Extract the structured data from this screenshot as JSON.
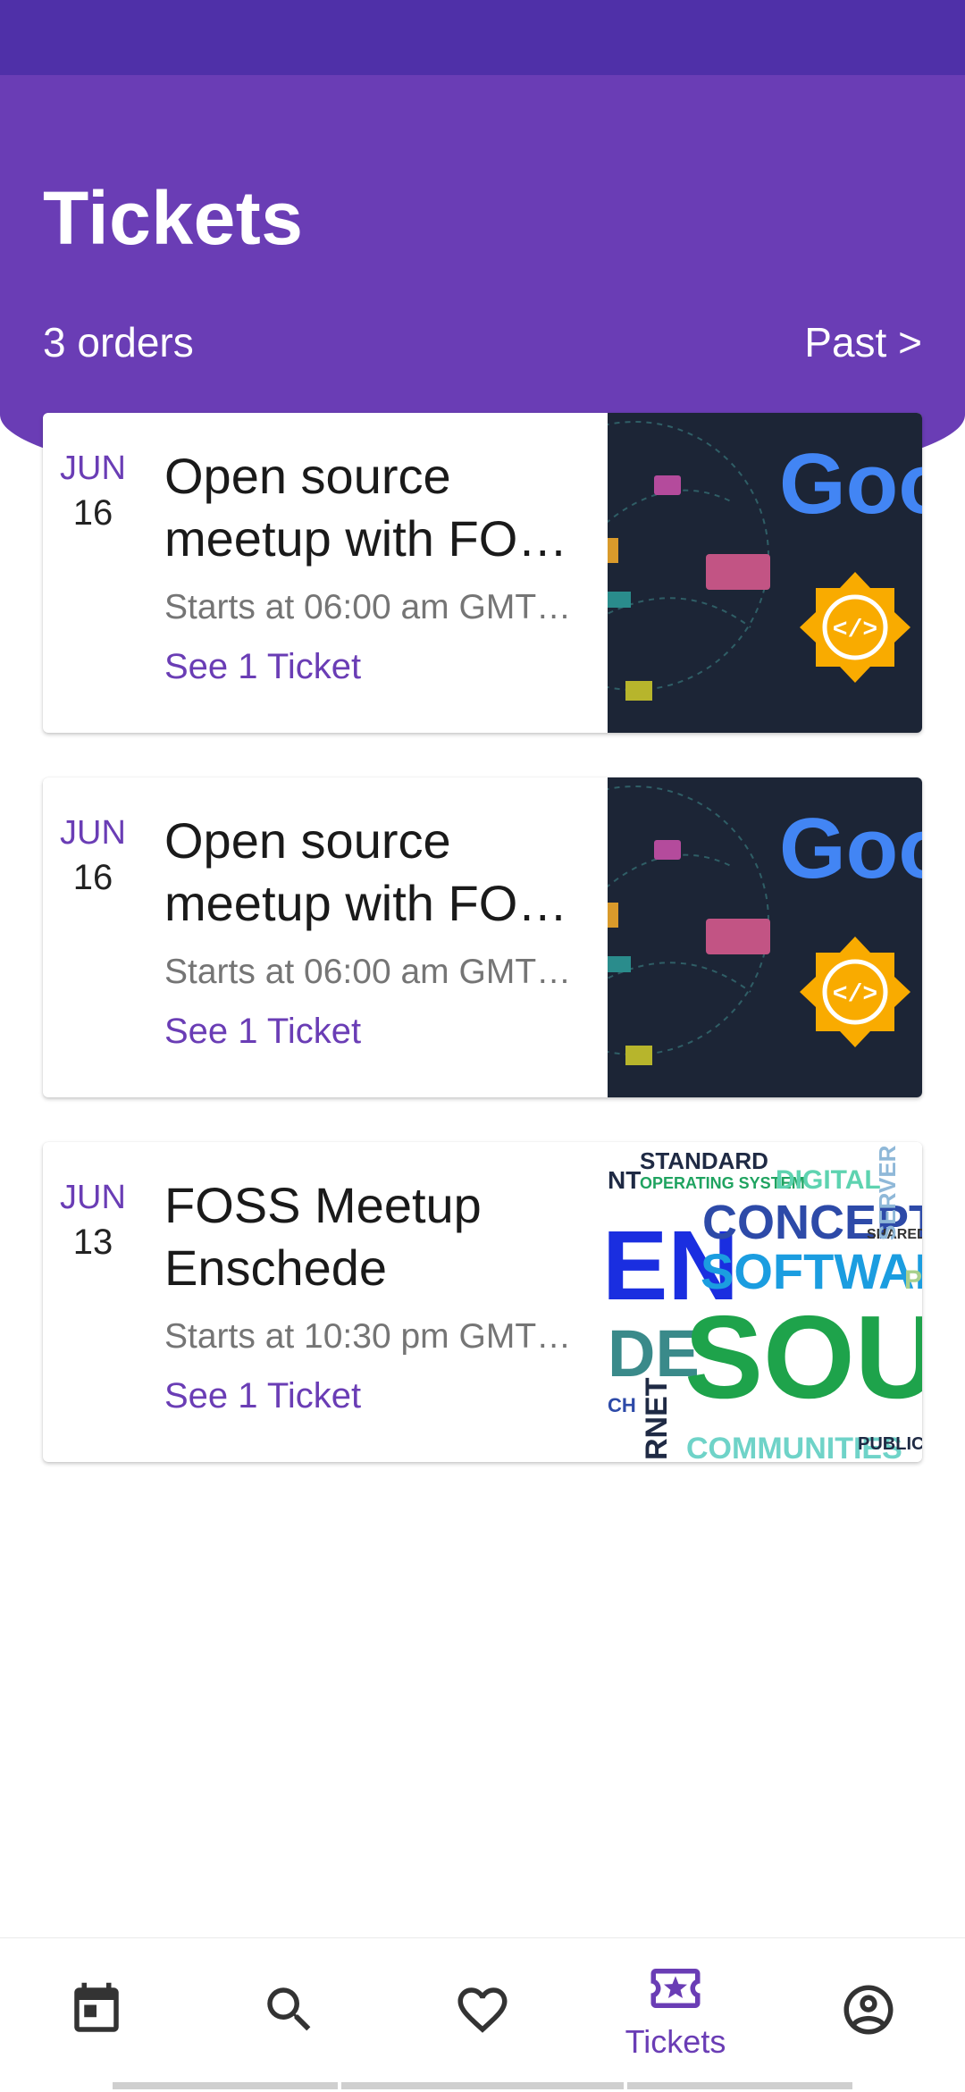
{
  "header": {
    "title": "Tickets",
    "orders_count": "3 orders",
    "past_link": "Past >"
  },
  "colors": {
    "primary": "#6a3db5",
    "statusbar": "#4f30a8",
    "thumb_dark": "#1c2536"
  },
  "orders": [
    {
      "month": "JUN",
      "day": "16",
      "title": "Open source meetup with FO…",
      "time": "Starts at 06:00 am GMT…",
      "action": "See 1 Ticket",
      "thumbnail_icon": "google-devs-logo-image"
    },
    {
      "month": "JUN",
      "day": "16",
      "title": "Open source meetup with FO…",
      "time": "Starts at 06:00 am GMT…",
      "action": "See 1 Ticket",
      "thumbnail_icon": "google-devs-logo-image"
    },
    {
      "month": "JUN",
      "day": "13",
      "title": "FOSS Meetup Enschede",
      "time": "Starts at 10:30 pm GMT…",
      "action": "See 1 Ticket",
      "thumbnail_icon": "open-source-word-cloud-image"
    }
  ],
  "thumb_text": {
    "google_logo": "Goo",
    "wc": {
      "standard": "STANDARD",
      "operating": "OPERATING SYSTEM",
      "digital": "DIGITAL",
      "concept": "CONCEPT",
      "software": "SOFTWARE",
      "shared": "SHARED",
      "server": "SERVER",
      "en": "EN",
      "de": "DE",
      "sour": "SOURC",
      "net": "RNET",
      "ch": "CH",
      "communities": "COMMUNITIES",
      "public": "PUBLIC",
      "nt": "NT",
      "p": "P"
    }
  },
  "bottom_nav": [
    {
      "icon": "calendar-icon",
      "label": ""
    },
    {
      "icon": "search-icon",
      "label": ""
    },
    {
      "icon": "heart-icon",
      "label": ""
    },
    {
      "icon": "ticket-icon",
      "label": "Tickets",
      "active": true
    },
    {
      "icon": "account-icon",
      "label": ""
    }
  ]
}
